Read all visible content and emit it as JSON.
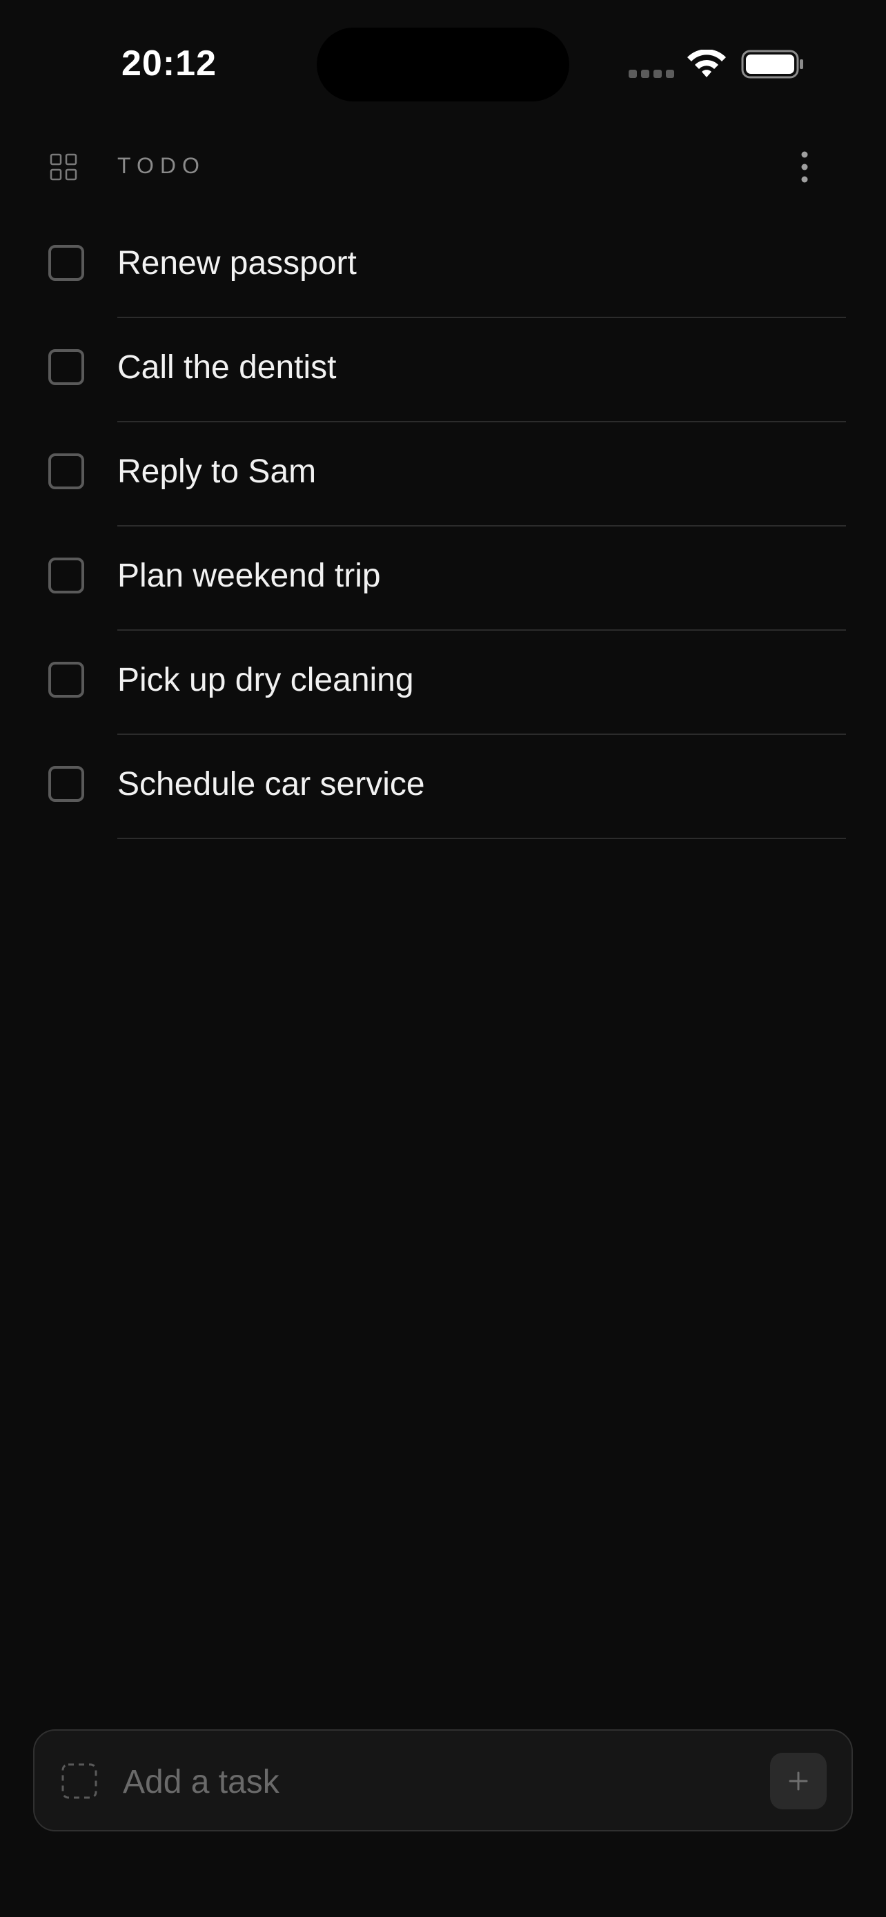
{
  "status_bar": {
    "time": "20:12"
  },
  "header": {
    "title": "TODO",
    "left_icon": "grid-icon",
    "right_icon": "more-vertical-icon"
  },
  "tasks": [
    {
      "label": "Renew passport",
      "checked": false
    },
    {
      "label": "Call the dentist",
      "checked": false
    },
    {
      "label": "Reply to Sam",
      "checked": false
    },
    {
      "label": "Plan weekend trip",
      "checked": false
    },
    {
      "label": "Pick up dry cleaning",
      "checked": false
    },
    {
      "label": "Schedule car service",
      "checked": false
    }
  ],
  "add_task": {
    "placeholder": "Add a task",
    "value": "",
    "leading_icon": "dashed-square-icon",
    "button_icon": "plus-icon"
  },
  "colors": {
    "background": "#0c0c0c",
    "text_primary": "#f2f2f2",
    "text_muted": "#8a8a8a",
    "divider": "#2c2c2c",
    "checkbox_border": "#5a5a5a"
  }
}
